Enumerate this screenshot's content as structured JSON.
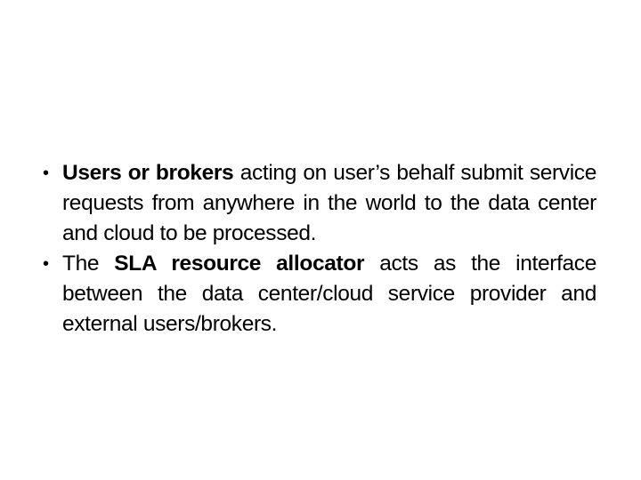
{
  "slide": {
    "bullets": [
      {
        "icon": "bullet-dot",
        "glyph": "•",
        "segments": [
          {
            "text": "Users or brokers",
            "bold": true
          },
          {
            "text": " acting on user’s behalf submit service requests from anywhere in the world to the data center and cloud to be processed.",
            "bold": false
          }
        ]
      },
      {
        "icon": "bullet-dot",
        "glyph": "•",
        "segments": [
          {
            "text": "The ",
            "bold": false
          },
          {
            "text": "SLA resource allocator",
            "bold": true
          },
          {
            "text": " acts as the interface between the data center/cloud service provider and external users/brokers.",
            "bold": false
          }
        ]
      }
    ]
  }
}
